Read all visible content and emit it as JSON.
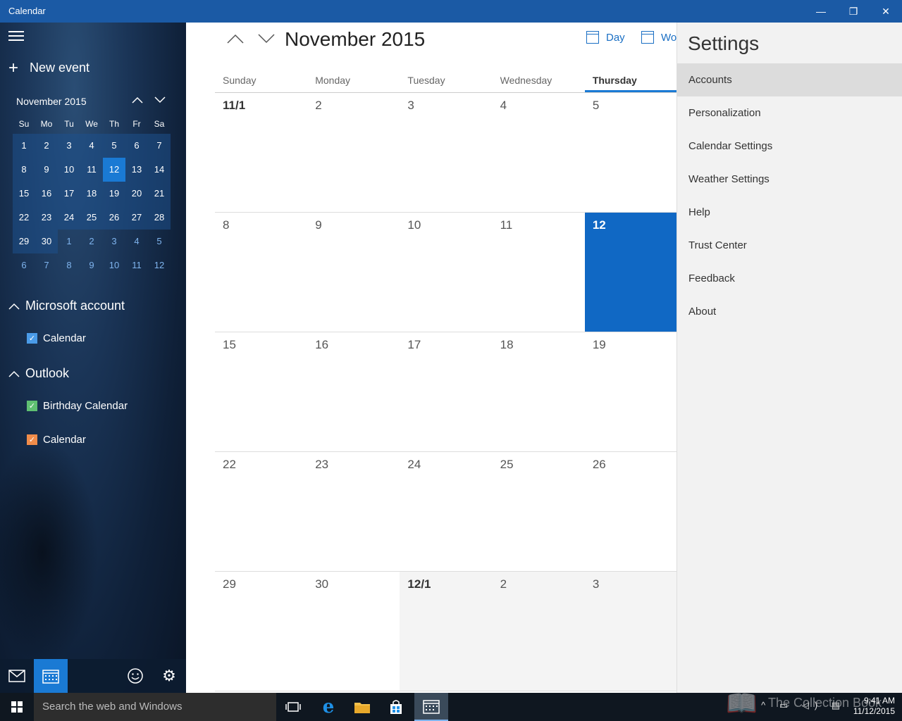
{
  "window": {
    "title": "Calendar",
    "minimize": "—",
    "restore": "❐",
    "close": "✕"
  },
  "sidebar": {
    "new_event": "New event",
    "mini_calendar": {
      "title": "November 2015",
      "weekdays": [
        "Su",
        "Mo",
        "Tu",
        "We",
        "Th",
        "Fr",
        "Sa"
      ],
      "weeks": [
        [
          "1",
          "2",
          "3",
          "4",
          "5",
          "6",
          "7"
        ],
        [
          "8",
          "9",
          "10",
          "11",
          "12",
          "13",
          "14"
        ],
        [
          "15",
          "16",
          "17",
          "18",
          "19",
          "20",
          "21"
        ],
        [
          "22",
          "23",
          "24",
          "25",
          "26",
          "27",
          "28"
        ],
        [
          "29",
          "30",
          "1",
          "2",
          "3",
          "4",
          "5"
        ],
        [
          "6",
          "7",
          "8",
          "9",
          "10",
          "11",
          "12"
        ]
      ],
      "today": "12"
    },
    "groups": [
      {
        "name": "Microsoft account",
        "calendars": [
          {
            "name": "Calendar",
            "color": "#4a9be8"
          }
        ]
      },
      {
        "name": "Outlook",
        "calendars": [
          {
            "name": "Birthday Calendar",
            "color": "#5fbf72"
          },
          {
            "name": "Calendar",
            "color": "#f08c4a"
          }
        ]
      }
    ]
  },
  "main": {
    "month_title": "November 2015",
    "views": {
      "day": "Day",
      "work_week": "Wor"
    },
    "weekdays": [
      "Sunday",
      "Monday",
      "Tuesday",
      "Wednesday",
      "Thursday"
    ],
    "weeks": [
      [
        "11/1",
        "2",
        "3",
        "4",
        "5"
      ],
      [
        "8",
        "9",
        "10",
        "11",
        "12"
      ],
      [
        "15",
        "16",
        "17",
        "18",
        "19"
      ],
      [
        "22",
        "23",
        "24",
        "25",
        "26"
      ],
      [
        "29",
        "30",
        "12/1",
        "2",
        "3"
      ]
    ]
  },
  "settings": {
    "title": "Settings",
    "items": [
      "Accounts",
      "Personalization",
      "Calendar Settings",
      "Weather Settings",
      "Help",
      "Trust Center",
      "Feedback",
      "About"
    ],
    "selected": "Accounts"
  },
  "taskbar": {
    "search_placeholder": "Search the web and Windows",
    "time": "9:41 AM",
    "date": "11/12/2015",
    "watermark": "The Collection Book"
  },
  "colors": {
    "titlebar": "#1b5aa5",
    "accent": "#1a7ad4",
    "today_cell": "#1068c4"
  }
}
